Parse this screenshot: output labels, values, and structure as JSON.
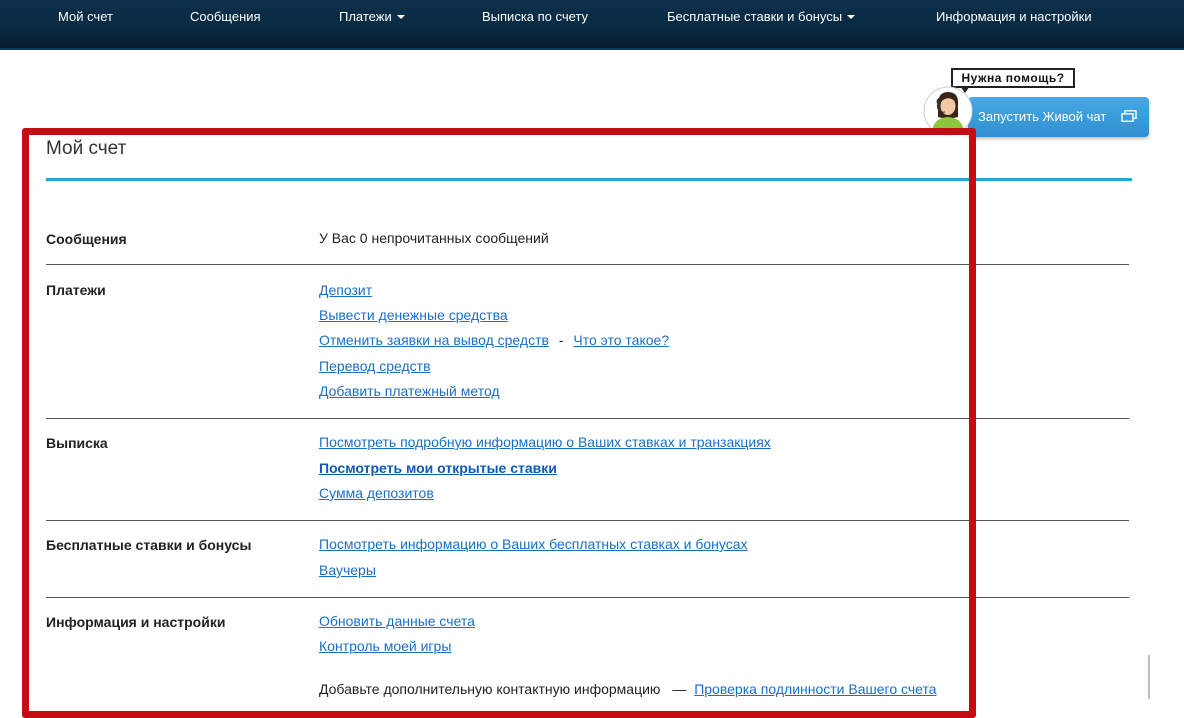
{
  "nav": {
    "items": [
      {
        "label": "Мой счет",
        "dropdown": false
      },
      {
        "label": "Сообщения",
        "dropdown": false
      },
      {
        "label": "Платежи",
        "dropdown": true
      },
      {
        "label": "Выписка по счету",
        "dropdown": false
      },
      {
        "label": "Бесплатные ставки и бонусы",
        "dropdown": true
      },
      {
        "label": "Информация и настройки",
        "dropdown": false
      }
    ]
  },
  "help": {
    "bubble": "Нужна помощь?",
    "chat_button": "Запустить Живой чат"
  },
  "page": {
    "title": "Мой счет"
  },
  "sections": {
    "messages": {
      "label": "Сообщения",
      "text": "У Вас 0 непрочитанных сообщений"
    },
    "payments": {
      "label": "Платежи",
      "links": [
        "Депозит",
        "Вывести денежные средства",
        "Отменить заявки на вывод средств",
        "Перевод средств",
        "Добавить платежный метод"
      ],
      "separator": "-",
      "what_is_this": "Что это такое?"
    },
    "statement": {
      "label": "Выписка",
      "links": [
        "Посмотреть подробную информацию о Ваших ставках и транзакциях",
        "Посмотреть мои открытые ставки",
        "Сумма депозитов"
      ]
    },
    "bonuses": {
      "label": "Бесплатные ставки и бонусы",
      "links": [
        "Посмотреть информацию о Ваших бесплатных ставках и бонусах",
        "Ваучеры"
      ]
    },
    "settings": {
      "label": "Информация и настройки",
      "links": [
        "Обновить данные счета",
        "Контроль моей игры"
      ],
      "contact_text": "Добавьте дополнительную контактную информацию",
      "dash": "—",
      "verify_link": "Проверка подлинности Вашего счета"
    }
  },
  "colors": {
    "nav_bg": "#0a2a42",
    "accent_rule": "#1ea8d6",
    "link": "#1a6fc7",
    "chat_button": "#2f8fd0",
    "annotation_frame": "#c40d12"
  }
}
